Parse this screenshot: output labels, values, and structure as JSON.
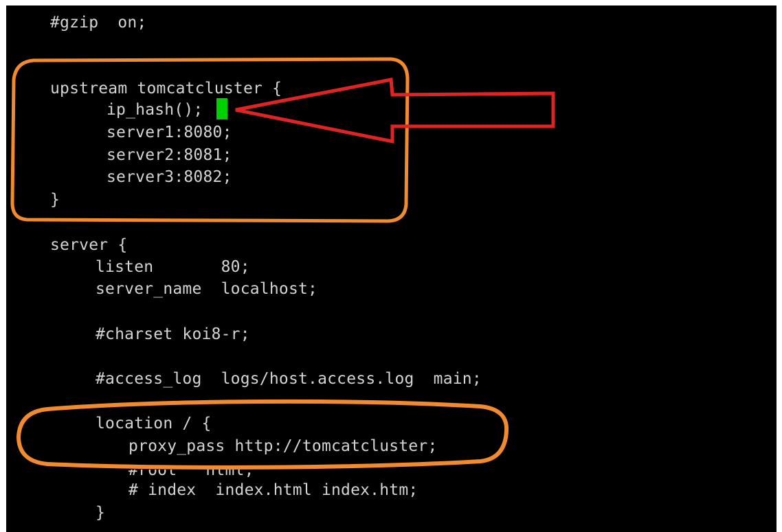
{
  "terminal": {
    "lines": [
      "#gzip  on;",
      "upstream tomcatcluster {",
      "ip_hash();",
      "server1:8080;",
      "server2:8081;",
      "server3:8082;",
      "}",
      "server {",
      "listen       80;",
      "server_name  localhost;",
      "#charset koi8-r;",
      "#access_log  logs/host.access.log  main;",
      "location / {",
      "proxy_pass http://tomcatcluster;",
      "#root   html;",
      "# index  index.html index.htm;",
      "}"
    ],
    "cursor_color": "#00d000",
    "text_color": "#d4d4d4",
    "background": "#000000"
  },
  "annotations": {
    "highlight_color": "#f28a2e",
    "arrow_color": "#e02424",
    "arrow_icon": "left-arrow-icon"
  }
}
